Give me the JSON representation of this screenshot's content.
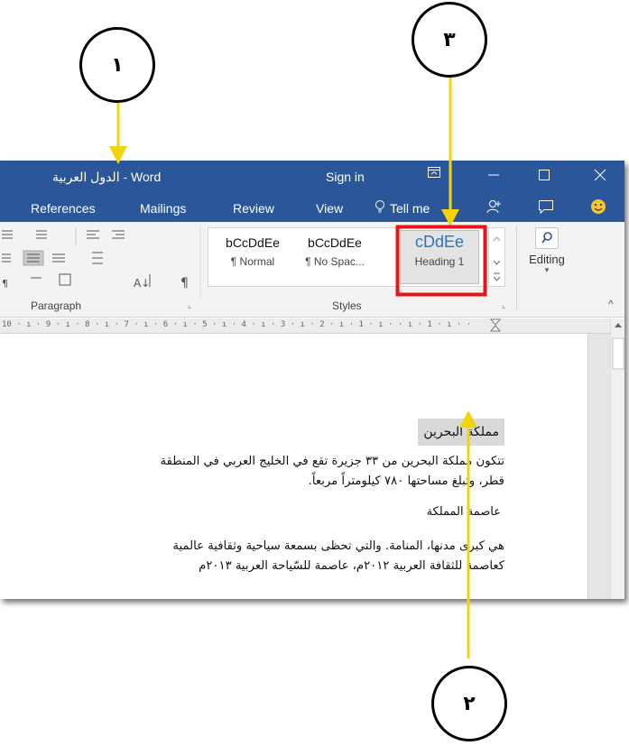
{
  "callouts": {
    "one": "١",
    "two": "٢",
    "three": "٣"
  },
  "titlebar": {
    "title": "الدول العربية  -  Word",
    "signin": "Sign in",
    "buttons": [
      "ribbon-display-options",
      "minimize",
      "maximize",
      "close"
    ]
  },
  "tabs": [
    "References",
    "Mailings",
    "Review",
    "View"
  ],
  "tellme": "Tell me",
  "ribbon": {
    "paragraph_label": "Paragraph",
    "styles_label": "Styles",
    "styles": [
      {
        "preview": "bCcDdEe",
        "name": "¶ Normal"
      },
      {
        "preview": "bCcDdEe",
        "name": "¶ No Spac..."
      },
      {
        "preview": "cDdEe",
        "name": "Heading 1"
      }
    ],
    "editing_label": "Editing"
  },
  "ruler": "10 · ı · 9 · ı · 8 · ı · 7 · ı · 6 · ı · 5 · ı · 4 · ı · 3 · ı · 2 · ı · 1 · ı ·   · ı · 1 · ı · ·",
  "document": {
    "heading": "مملكة البحرين",
    "para1_line1": "تتكون مملكة البحرين من ٣٣ جزيرة تقع في الخليج العربي في المنطقة",
    "para1_line2": "قطر، وتبلغ مساحتها ٧٨٠ كيلومتراً مربعاً.",
    "subheading": "عاصمة المملكة",
    "para2_line1": "هي كبرى مدنها، المنامة. والتي تحظى بسمعة سياحية وثقافية عالمية",
    "para2_line2": "كعاصمة للثقافة العربية ٢٠١٢م، عاصمة للسّياحة العربية ٢٠١٣م"
  },
  "colors": {
    "titlebar": "#2b579a",
    "highlight_box": "#e8141b",
    "arrow": "#f2d40c"
  },
  "icons": [
    "ribbon-display-icon",
    "minimize-icon",
    "maximize-icon",
    "close-icon",
    "lightbulb-icon",
    "share-icon",
    "comments-icon",
    "smiley-icon",
    "find-icon"
  ]
}
